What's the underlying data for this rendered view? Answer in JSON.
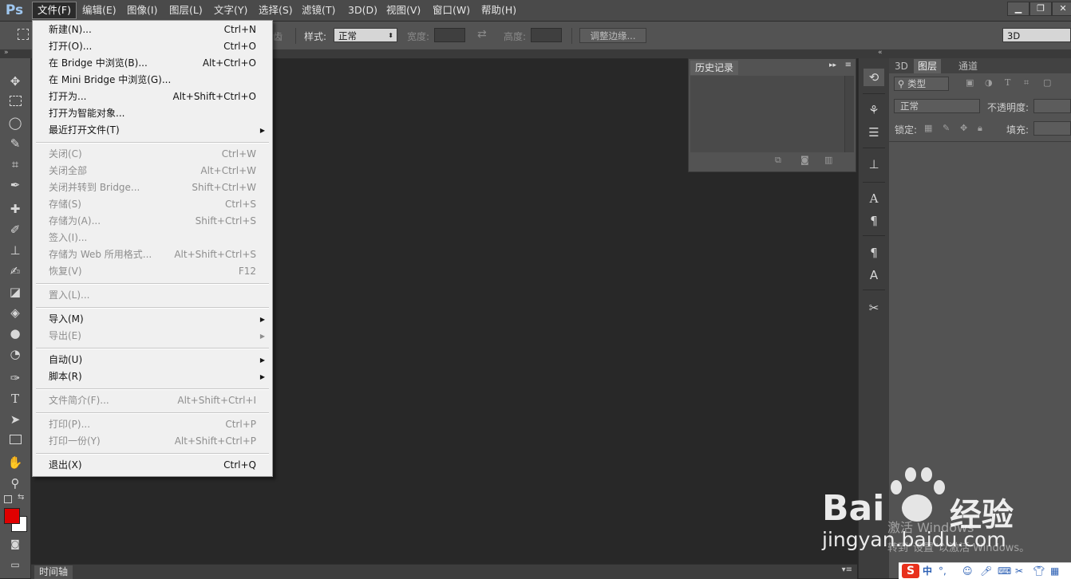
{
  "app": {
    "logo": "Ps"
  },
  "menubar": {
    "items": [
      "文件(F)",
      "编辑(E)",
      "图像(I)",
      "图层(L)",
      "文字(Y)",
      "选择(S)",
      "滤镜(T)",
      "3D(D)",
      "视图(V)",
      "窗口(W)",
      "帮助(H)"
    ],
    "active_index": 0
  },
  "window_controls": {
    "minimize": "▁",
    "restore": "❐",
    "close": "✕"
  },
  "options_bar": {
    "partial_label": "消除锯齿",
    "style_label": "样式:",
    "style_value": "正常",
    "width_label": "宽度:",
    "height_label": "高度:",
    "refine_edge_button": "调整边缘...",
    "workspace_value": "3D"
  },
  "file_menu": {
    "groups": [
      [
        {
          "label": "新建(N)...",
          "shortcut": "Ctrl+N",
          "enabled": true
        },
        {
          "label": "打开(O)...",
          "shortcut": "Ctrl+O",
          "enabled": true
        },
        {
          "label": "在 Bridge 中浏览(B)...",
          "shortcut": "Alt+Ctrl+O",
          "enabled": true
        },
        {
          "label": "在 Mini Bridge 中浏览(G)...",
          "shortcut": "",
          "enabled": true
        },
        {
          "label": "打开为...",
          "shortcut": "Alt+Shift+Ctrl+O",
          "enabled": true
        },
        {
          "label": "打开为智能对象...",
          "shortcut": "",
          "enabled": true
        },
        {
          "label": "最近打开文件(T)",
          "shortcut": "",
          "enabled": true,
          "submenu": true
        }
      ],
      [
        {
          "label": "关闭(C)",
          "shortcut": "Ctrl+W",
          "enabled": false
        },
        {
          "label": "关闭全部",
          "shortcut": "Alt+Ctrl+W",
          "enabled": false
        },
        {
          "label": "关闭并转到 Bridge...",
          "shortcut": "Shift+Ctrl+W",
          "enabled": false
        },
        {
          "label": "存储(S)",
          "shortcut": "Ctrl+S",
          "enabled": false
        },
        {
          "label": "存储为(A)...",
          "shortcut": "Shift+Ctrl+S",
          "enabled": false
        },
        {
          "label": "签入(I)...",
          "shortcut": "",
          "enabled": false
        },
        {
          "label": "存储为 Web 所用格式...",
          "shortcut": "Alt+Shift+Ctrl+S",
          "enabled": false
        },
        {
          "label": "恢复(V)",
          "shortcut": "F12",
          "enabled": false
        }
      ],
      [
        {
          "label": "置入(L)...",
          "shortcut": "",
          "enabled": false
        }
      ],
      [
        {
          "label": "导入(M)",
          "shortcut": "",
          "enabled": true,
          "submenu": true
        },
        {
          "label": "导出(E)",
          "shortcut": "",
          "enabled": false,
          "submenu": true
        }
      ],
      [
        {
          "label": "自动(U)",
          "shortcut": "",
          "enabled": true,
          "submenu": true
        },
        {
          "label": "脚本(R)",
          "shortcut": "",
          "enabled": true,
          "submenu": true
        }
      ],
      [
        {
          "label": "文件简介(F)...",
          "shortcut": "Alt+Shift+Ctrl+I",
          "enabled": false
        }
      ],
      [
        {
          "label": "打印(P)...",
          "shortcut": "Ctrl+P",
          "enabled": false
        },
        {
          "label": "打印一份(Y)",
          "shortcut": "Alt+Shift+Ctrl+P",
          "enabled": false
        }
      ],
      [
        {
          "label": "退出(X)",
          "shortcut": "Ctrl+Q",
          "enabled": true
        }
      ]
    ]
  },
  "history_panel": {
    "title": "历史记录"
  },
  "layers_panel": {
    "tabs": [
      "3D",
      "图层",
      "通道"
    ],
    "active_tab": 1,
    "filter_label": "类型",
    "blend_mode": "正常",
    "opacity_label": "不透明度:",
    "lock_label": "锁定:",
    "fill_label": "填充:"
  },
  "timeline": {
    "tab": "时间轴"
  },
  "colors": {
    "foreground": "#e00000",
    "background": "#ffffff",
    "menu_bg": "#f0f0f0"
  },
  "watermark": {
    "brand_left": "Bai",
    "brand_right": "经验",
    "url": "jingyan.baidu.com",
    "activate_line1": "激活 Windows",
    "activate_line2": "转到\"设置\"以激活 Windows。"
  },
  "tray": {
    "ime": "中",
    "punct": "°,"
  }
}
